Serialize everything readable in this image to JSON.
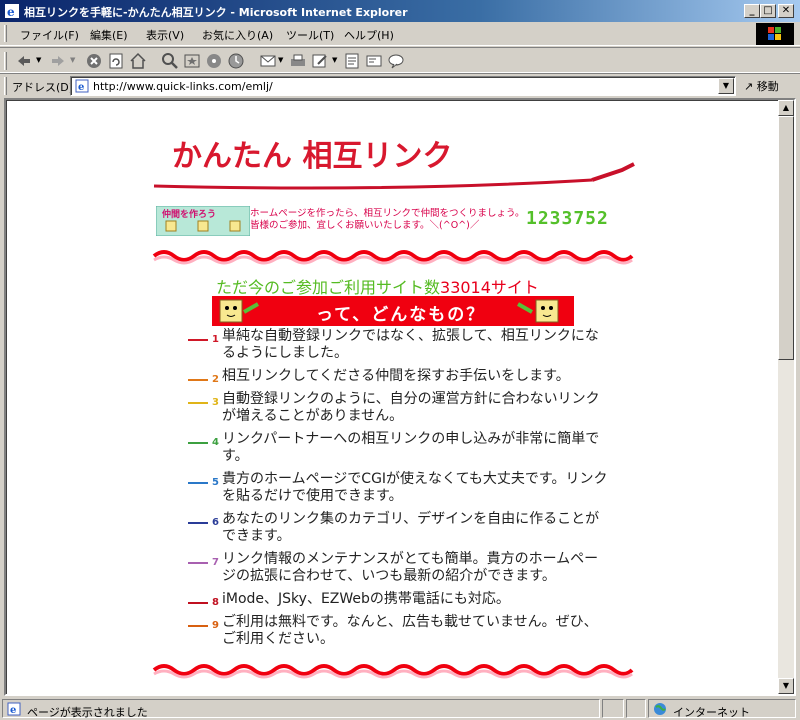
{
  "window": {
    "title": "相互リンクを手軽に-かんたん相互リンク - Microsoft Internet Explorer",
    "minimize": "_",
    "maximize": "□",
    "close": "✕"
  },
  "menu": [
    "ファイル(F)",
    "編集(E)",
    "表示(V)",
    "お気に入り(A)",
    "ツール(T)",
    "ヘルプ(H)"
  ],
  "address": {
    "label": "アドレス(D)",
    "url": "http://www.quick-links.com/emlj/",
    "go_label": "移動"
  },
  "page": {
    "logo_text": "かんたん 相互リンク",
    "banner_label": "仲間を作ろう",
    "banner_text": "ホームページを作ったら、相互リンクで仲間をつくりましょう。皆様のご参加、宜しくお願いいたします。＼(^O^)／",
    "counter": "1233752",
    "site_count_prefix": "ただ今のご参加ご利用サイト数",
    "site_count_number": "33014",
    "site_count_suffix": "サイト",
    "what_is_it": "って、どんなもの？",
    "features": [
      {
        "num": "1",
        "color": "#d01828",
        "text": "単純な自動登録リンクではなく、拡張して、相互リンクになるようにしました。"
      },
      {
        "num": "2",
        "color": "#e07818",
        "text": "相互リンクしてくださる仲間を探すお手伝いをします。"
      },
      {
        "num": "3",
        "color": "#e0b418",
        "text": "自動登録リンクのように、自分の運営方針に合わないリンクが増えることがありません。"
      },
      {
        "num": "4",
        "color": "#3ca040",
        "text": "リンクパートナーへの相互リンクの申し込みが非常に簡単です。"
      },
      {
        "num": "5",
        "color": "#2a78c8",
        "text": "貴方のホームページでCGIが使えなくても大丈夫です。リンクを貼るだけで使用できます。"
      },
      {
        "num": "6",
        "color": "#2a3c98",
        "text": "あなたのリンク集のカテゴリ、デザインを自由に作ることができます。"
      },
      {
        "num": "7",
        "color": "#a860b0",
        "text": "リンク情報のメンテナンスがとても簡単。貴方のホームページの拡張に合わせて、いつも最新の紹介ができます。"
      },
      {
        "num": "8",
        "color": "#c01020",
        "text": "iMode、JSky、EZWebの携帯電話にも対応。"
      },
      {
        "num": "9",
        "color": "#d86010",
        "text": "ご利用は無料です。なんと、広告も載せていません。ぜひ、ご利用ください。"
      }
    ]
  },
  "status": {
    "text": "ページが表示されました",
    "zone": "インターネット"
  }
}
